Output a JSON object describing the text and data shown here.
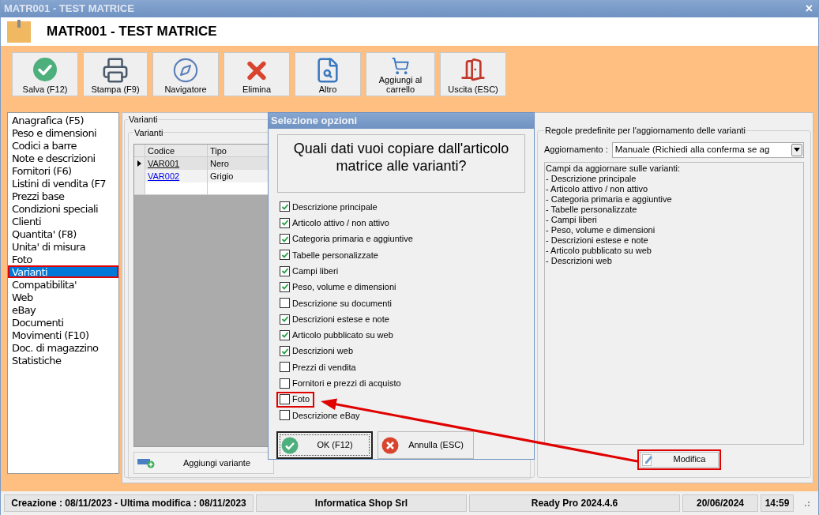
{
  "window": {
    "title": "MATR001 - TEST MATRICE",
    "close": "×"
  },
  "header": {
    "title": "MATR001 - TEST MATRICE"
  },
  "toolbar": [
    {
      "label": "Salva (F12)",
      "kind": "save"
    },
    {
      "label": "Stampa (F9)",
      "kind": "print"
    },
    {
      "label": "Navigatore",
      "kind": "navigate"
    },
    {
      "label": "Elimina",
      "kind": "delete"
    },
    {
      "label": "Altro",
      "kind": "more"
    },
    {
      "label": "Aggiungi al carrello",
      "kind": "cart"
    },
    {
      "label": "Uscita (ESC)",
      "kind": "exit"
    }
  ],
  "sidebar": {
    "items": [
      {
        "label": "Anagrafica (F5)",
        "selected": false,
        "highlighted": false
      },
      {
        "label": "Peso e dimensioni",
        "selected": false,
        "highlighted": false
      },
      {
        "label": "Codici a barre",
        "selected": false,
        "highlighted": false
      },
      {
        "label": "Note e descrizioni",
        "selected": false,
        "highlighted": false
      },
      {
        "label": "Fornitori (F6)",
        "selected": false,
        "highlighted": false
      },
      {
        "label": "Listini di vendita (F7",
        "selected": false,
        "highlighted": false
      },
      {
        "label": "Prezzi base",
        "selected": false,
        "highlighted": false
      },
      {
        "label": "Condizioni speciali",
        "selected": false,
        "highlighted": false
      },
      {
        "label": "Clienti",
        "selected": false,
        "highlighted": false
      },
      {
        "label": "Quantita' (F8)",
        "selected": false,
        "highlighted": false
      },
      {
        "label": "Unita' di misura",
        "selected": false,
        "highlighted": false
      },
      {
        "label": "Foto",
        "selected": false,
        "highlighted": false
      },
      {
        "label": "Varianti",
        "selected": true,
        "highlighted": true
      },
      {
        "label": "Compatibilita'",
        "selected": false,
        "highlighted": false
      },
      {
        "label": "Web",
        "selected": false,
        "highlighted": false
      },
      {
        "label": "eBay",
        "selected": false,
        "highlighted": false
      },
      {
        "label": "Documenti",
        "selected": false,
        "highlighted": false
      },
      {
        "label": "Movimenti (F10)",
        "selected": false,
        "highlighted": false
      },
      {
        "label": "Doc. di magazzino",
        "selected": false,
        "highlighted": false
      },
      {
        "label": "Statistiche",
        "selected": false,
        "highlighted": false
      }
    ]
  },
  "variants_panel": {
    "title": "Varianti",
    "group_title": "Varianti",
    "table": {
      "columns": [
        "Codice",
        "Tipo"
      ],
      "rows": [
        {
          "cells": [
            "VAR001",
            "Nero"
          ],
          "selected": true
        },
        {
          "cells": [
            "VAR002",
            "Grigio"
          ],
          "selected": false
        }
      ]
    },
    "add_button": "Aggiungi variante"
  },
  "rules_panel": {
    "title": "Regole predefinite per l'aggiornamento delle varianti",
    "update_label": "Aggiornamento :",
    "update_value": "Manuale (Richiedi alla conferma se ag",
    "fields_text": [
      "Campi da aggiornare sulle varianti:",
      "- Descrizione principale",
      "- Articolo attivo / non attivo",
      "- Categoria primaria e aggiuntive",
      "- Tabelle personalizzate",
      "- Campi liberi",
      "- Peso, volume e dimensioni",
      "- Descrizioni estese e note",
      "- Articolo pubblicato su web",
      "- Descrizioni web"
    ],
    "edit_button": {
      "label": "Modifica",
      "highlighted": true
    }
  },
  "dialog": {
    "title": "Selezione opzioni",
    "question": "Quali dati vuoi copiare dall'articolo matrice alle varianti?",
    "options": [
      {
        "label": "Descrizione principale",
        "checked": true,
        "highlighted": false
      },
      {
        "label": "Articolo attivo / non attivo",
        "checked": true,
        "highlighted": false
      },
      {
        "label": "Categoria primaria e aggiuntive",
        "checked": true,
        "highlighted": false
      },
      {
        "label": "Tabelle personalizzate",
        "checked": true,
        "highlighted": false
      },
      {
        "label": "Campi liberi",
        "checked": true,
        "highlighted": false
      },
      {
        "label": "Peso, volume e dimensioni",
        "checked": true,
        "highlighted": false
      },
      {
        "label": "Descrizione su documenti",
        "checked": false,
        "highlighted": false
      },
      {
        "label": "Descrizioni estese e note",
        "checked": true,
        "highlighted": false
      },
      {
        "label": "Articolo pubblicato su web",
        "checked": true,
        "highlighted": false
      },
      {
        "label": "Descrizioni web",
        "checked": true,
        "highlighted": false
      },
      {
        "label": "Prezzi di vendita",
        "checked": false,
        "highlighted": false
      },
      {
        "label": "Fornitori e prezzi di acquisto",
        "checked": false,
        "highlighted": false
      },
      {
        "label": "Foto",
        "checked": false,
        "highlighted": true
      },
      {
        "label": "Descrizione eBay",
        "checked": false,
        "highlighted": false
      }
    ],
    "buttons": [
      {
        "label": "OK (F12)",
        "kind": "ok",
        "default": true
      },
      {
        "label": "Annulla (ESC)",
        "kind": "cancel",
        "default": false
      }
    ]
  },
  "status_bar": [
    "Creazione : 08/11/2023 - Ultima modifica : 08/11/2023",
    "Informatica Shop Srl",
    "Ready Pro 2024.4.6",
    "20/06/2024",
    "14:59"
  ]
}
